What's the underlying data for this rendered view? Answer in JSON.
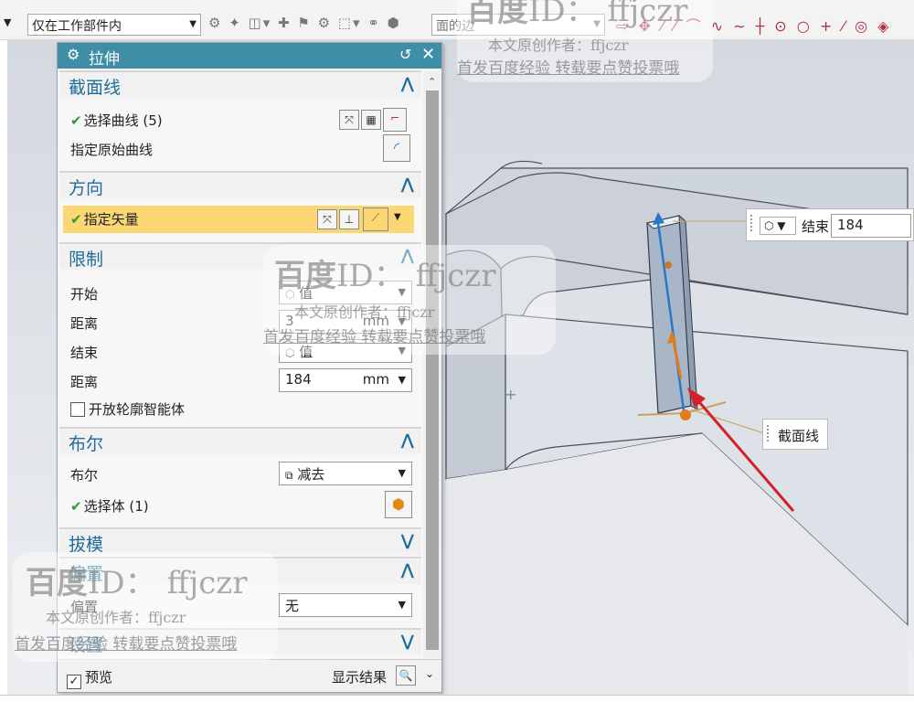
{
  "toolbar": {
    "filter_scope": "仅在工作部件内",
    "face_edge_selector": "面的边"
  },
  "dialog": {
    "title": "拉伸",
    "sections": {
      "section_curve": {
        "title": "截面线",
        "select_curve": "选择曲线 (5)",
        "specify_original_curve": "指定原始曲线"
      },
      "direction": {
        "title": "方向",
        "specify_vector": "指定矢量"
      },
      "limits": {
        "title": "限制",
        "start_label": "开始",
        "start_value": "值",
        "distance_label_1": "距离",
        "distance_1": "3",
        "unit_1": "mm",
        "end_label": "结束",
        "end_value": "值",
        "distance_label_2": "距离",
        "distance_2": "184",
        "unit_2": "mm",
        "open_profile": "开放轮廓智能体"
      },
      "boolean": {
        "title": "布尔",
        "boolean_label": "布尔",
        "boolean_value": "减去",
        "select_body": "选择体 (1)"
      },
      "draft": {
        "title": "拔模"
      },
      "offset": {
        "title": "偏置",
        "offset_label": "偏置",
        "offset_value": "无"
      },
      "settings": {
        "title": "设置"
      }
    },
    "footer": {
      "preview": "预览",
      "show_result": "显示结果"
    }
  },
  "viewport": {
    "end_callout_label": "结束",
    "end_callout_value": "184",
    "section_callout_label": "截面线"
  },
  "watermarks": {
    "brand": "百度",
    "id_label": "ID：",
    "user": "ffjczr",
    "author_line": "本文原创作者：ffjczr",
    "promo_line": "首发百度经验 转载要点赞投票哦"
  },
  "colors": {
    "title_bar": "#3f8ea8",
    "section_heading": "#1f6d9b",
    "highlight_row": "#fbd774",
    "arrow": "#d42027"
  }
}
